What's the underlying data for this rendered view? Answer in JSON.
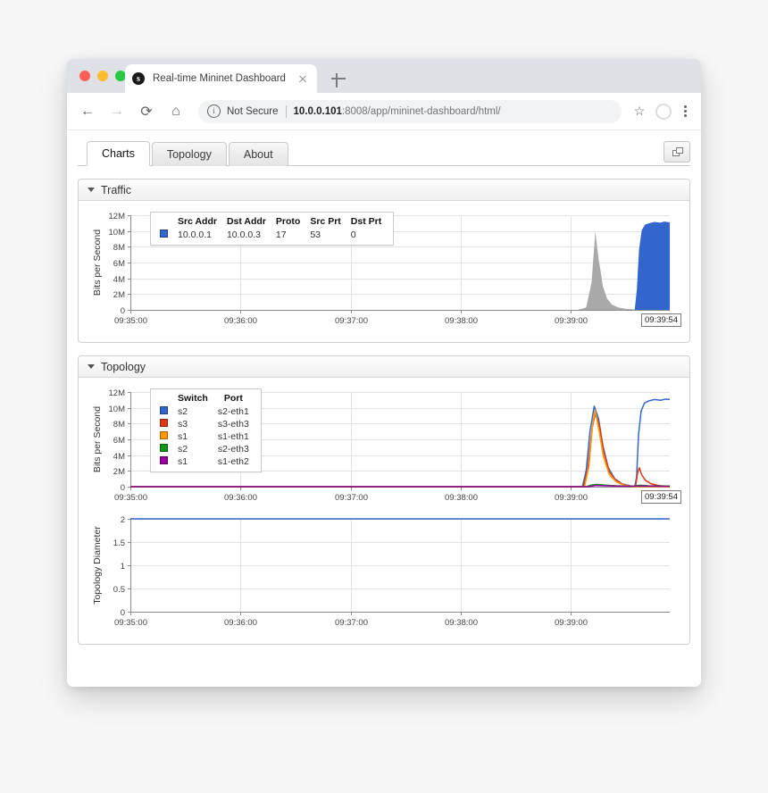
{
  "browser": {
    "tab_title": "Real-time Mininet Dashboard",
    "favicon_letter": "s",
    "close_icon": "close-icon",
    "newtab_icon": "new-tab-icon",
    "back_icon": "←",
    "forward_icon": "→",
    "reload_icon": "⟳",
    "home_icon": "⌂",
    "security_label": "Not Secure",
    "url_host": "10.0.0.101",
    "url_rest": ":8008/app/mininet-dashboard/html/",
    "star_icon": "☆",
    "menu_icon": "kebab-menu-icon"
  },
  "app": {
    "tabs": [
      {
        "label": "Charts",
        "active": true
      },
      {
        "label": "Topology",
        "active": false
      },
      {
        "label": "About",
        "active": false
      }
    ],
    "corner_button": "popout-window-icon",
    "panels": [
      {
        "title": "Traffic"
      },
      {
        "title": "Topology"
      }
    ]
  },
  "chart_data": [
    {
      "type": "area",
      "title": "Traffic",
      "ylabel": "Bits per Second",
      "xlabel": "",
      "yticks": [
        "0",
        "2M",
        "4M",
        "6M",
        "8M",
        "10M",
        "12M"
      ],
      "ylim": [
        0,
        12000000
      ],
      "xticks": [
        "09:35:00",
        "09:36:00",
        "09:37:00",
        "09:38:00",
        "09:39:00"
      ],
      "xlim": [
        "09:35:00",
        "09:39:54"
      ],
      "end_label": "09:39:54",
      "grid": true,
      "legend_position": "top-left-overlay",
      "legend_columns": [
        "Src Addr",
        "Dst Addr",
        "Proto",
        "Src Prt",
        "Dst Prt"
      ],
      "legend_rows": [
        {
          "color": "#3366cc",
          "src_addr": "10.0.0.1",
          "dst_addr": "10.0.0.3",
          "proto": "17",
          "src_prt": "53",
          "dst_prt": "0"
        }
      ],
      "series": [
        {
          "name": "other",
          "color": "#a9a9a9",
          "points": [
            {
              "t": 0.0,
              "v": 0
            },
            {
              "t": 0.83,
              "v": 0
            },
            {
              "t": 0.845,
              "v": 300000
            },
            {
              "t": 0.855,
              "v": 3500000
            },
            {
              "t": 0.862,
              "v": 9900000
            },
            {
              "t": 0.868,
              "v": 6500000
            },
            {
              "t": 0.876,
              "v": 3000000
            },
            {
              "t": 0.884,
              "v": 1400000
            },
            {
              "t": 0.893,
              "v": 650000
            },
            {
              "t": 0.905,
              "v": 300000
            },
            {
              "t": 0.92,
              "v": 120000
            },
            {
              "t": 0.94,
              "v": 40000
            },
            {
              "t": 1.0,
              "v": 0
            }
          ]
        },
        {
          "name": "10.0.0.1 → 10.0.0.3",
          "color": "#3366cc",
          "points": [
            {
              "t": 0.0,
              "v": 0
            },
            {
              "t": 0.935,
              "v": 0
            },
            {
              "t": 0.939,
              "v": 2600000
            },
            {
              "t": 0.943,
              "v": 7600000
            },
            {
              "t": 0.948,
              "v": 10100000
            },
            {
              "t": 0.954,
              "v": 10800000
            },
            {
              "t": 0.962,
              "v": 11000000
            },
            {
              "t": 0.972,
              "v": 11150000
            },
            {
              "t": 0.982,
              "v": 11050000
            },
            {
              "t": 0.99,
              "v": 11200000
            },
            {
              "t": 1.0,
              "v": 11100000
            }
          ]
        }
      ]
    },
    {
      "type": "line",
      "title": "Topology",
      "ylabel": "Bits per Second",
      "xlabel": "",
      "yticks": [
        "0",
        "2M",
        "4M",
        "6M",
        "8M",
        "10M",
        "12M"
      ],
      "ylim": [
        0,
        12000000
      ],
      "xticks": [
        "09:35:00",
        "09:36:00",
        "09:37:00",
        "09:38:00",
        "09:39:00"
      ],
      "xlim": [
        "09:35:00",
        "09:39:54"
      ],
      "end_label": "09:39:54",
      "grid": true,
      "legend_position": "top-left-overlay",
      "legend_columns": [
        "Switch",
        "Port"
      ],
      "legend_rows": [
        {
          "color": "#3366cc",
          "switch": "s2",
          "port": "s2-eth1"
        },
        {
          "color": "#dc3912",
          "switch": "s3",
          "port": "s3-eth3"
        },
        {
          "color": "#ff9900",
          "switch": "s1",
          "port": "s1-eth1"
        },
        {
          "color": "#109618",
          "switch": "s2",
          "port": "s2-eth3"
        },
        {
          "color": "#990099",
          "switch": "s1",
          "port": "s1-eth2"
        }
      ],
      "series": [
        {
          "name": "s2 s2-eth1",
          "color": "#3366cc",
          "points": [
            {
              "t": 0.0,
              "v": 0
            },
            {
              "t": 0.838,
              "v": 0
            },
            {
              "t": 0.845,
              "v": 2000000
            },
            {
              "t": 0.852,
              "v": 7000000
            },
            {
              "t": 0.86,
              "v": 10200000
            },
            {
              "t": 0.868,
              "v": 8600000
            },
            {
              "t": 0.876,
              "v": 5200000
            },
            {
              "t": 0.886,
              "v": 2400000
            },
            {
              "t": 0.898,
              "v": 1000000
            },
            {
              "t": 0.912,
              "v": 350000
            },
            {
              "t": 0.928,
              "v": 90000
            },
            {
              "t": 0.935,
              "v": 0
            },
            {
              "t": 0.9385,
              "v": 1200000
            },
            {
              "t": 0.942,
              "v": 6500000
            },
            {
              "t": 0.947,
              "v": 9600000
            },
            {
              "t": 0.953,
              "v": 10600000
            },
            {
              "t": 0.962,
              "v": 10900000
            },
            {
              "t": 0.972,
              "v": 11050000
            },
            {
              "t": 0.983,
              "v": 10950000
            },
            {
              "t": 0.992,
              "v": 11100000
            },
            {
              "t": 1.0,
              "v": 11050000
            }
          ]
        },
        {
          "name": "s3 s3-eth3",
          "color": "#dc3912",
          "points": [
            {
              "t": 0.0,
              "v": 0
            },
            {
              "t": 0.84,
              "v": 0
            },
            {
              "t": 0.848,
              "v": 2200000
            },
            {
              "t": 0.856,
              "v": 7400000
            },
            {
              "t": 0.862,
              "v": 9300000
            },
            {
              "t": 0.87,
              "v": 7600000
            },
            {
              "t": 0.878,
              "v": 4300000
            },
            {
              "t": 0.888,
              "v": 1900000
            },
            {
              "t": 0.9,
              "v": 800000
            },
            {
              "t": 0.914,
              "v": 260000
            },
            {
              "t": 0.93,
              "v": 60000
            },
            {
              "t": 0.9365,
              "v": 0
            },
            {
              "t": 0.9405,
              "v": 1800000
            },
            {
              "t": 0.9435,
              "v": 2400000
            },
            {
              "t": 0.948,
              "v": 1500000
            },
            {
              "t": 0.955,
              "v": 800000
            },
            {
              "t": 0.965,
              "v": 380000
            },
            {
              "t": 0.978,
              "v": 160000
            },
            {
              "t": 0.99,
              "v": 60000
            },
            {
              "t": 1.0,
              "v": 20000
            }
          ]
        },
        {
          "name": "s1 s1-eth1",
          "color": "#ff9900",
          "points": [
            {
              "t": 0.0,
              "v": 0
            },
            {
              "t": 0.842,
              "v": 0
            },
            {
              "t": 0.85,
              "v": 2500000
            },
            {
              "t": 0.857,
              "v": 7900000
            },
            {
              "t": 0.8615,
              "v": 9700000
            },
            {
              "t": 0.869,
              "v": 7000000
            },
            {
              "t": 0.877,
              "v": 3800000
            },
            {
              "t": 0.888,
              "v": 1500000
            },
            {
              "t": 0.901,
              "v": 600000
            },
            {
              "t": 0.916,
              "v": 180000
            },
            {
              "t": 0.935,
              "v": 0
            },
            {
              "t": 1.0,
              "v": 0
            }
          ]
        },
        {
          "name": "s2 s2-eth3",
          "color": "#109618",
          "points": [
            {
              "t": 0.0,
              "v": 0
            },
            {
              "t": 0.845,
              "v": 0
            },
            {
              "t": 0.855,
              "v": 220000
            },
            {
              "t": 0.865,
              "v": 300000
            },
            {
              "t": 0.88,
              "v": 200000
            },
            {
              "t": 0.9,
              "v": 120000
            },
            {
              "t": 0.93,
              "v": 60000
            },
            {
              "t": 0.945,
              "v": 190000
            },
            {
              "t": 0.96,
              "v": 120000
            },
            {
              "t": 1.0,
              "v": 80000
            }
          ]
        },
        {
          "name": "s1 s1-eth2",
          "color": "#990099",
          "points": [
            {
              "t": 0.0,
              "v": 0
            },
            {
              "t": 0.85,
              "v": 0
            },
            {
              "t": 0.862,
              "v": 150000
            },
            {
              "t": 0.88,
              "v": 110000
            },
            {
              "t": 0.92,
              "v": 50000
            },
            {
              "t": 0.95,
              "v": 90000
            },
            {
              "t": 1.0,
              "v": 40000
            }
          ]
        }
      ]
    },
    {
      "type": "line",
      "title": "",
      "ylabel": "Topology Diameter",
      "xlabel": "",
      "yticks": [
        "0",
        "0.5",
        "1",
        "1.5",
        "2"
      ],
      "ylim": [
        0,
        2
      ],
      "xticks": [
        "09:35:00",
        "09:36:00",
        "09:37:00",
        "09:38:00",
        "09:39:00"
      ],
      "xlim": [
        "09:35:00",
        "09:39:54"
      ],
      "end_label": "",
      "grid": true,
      "legend_position": "none",
      "series": [
        {
          "name": "diameter",
          "color": "#3366cc",
          "points": [
            {
              "t": 0.0,
              "v": 2
            },
            {
              "t": 1.0,
              "v": 2
            }
          ]
        }
      ]
    }
  ]
}
